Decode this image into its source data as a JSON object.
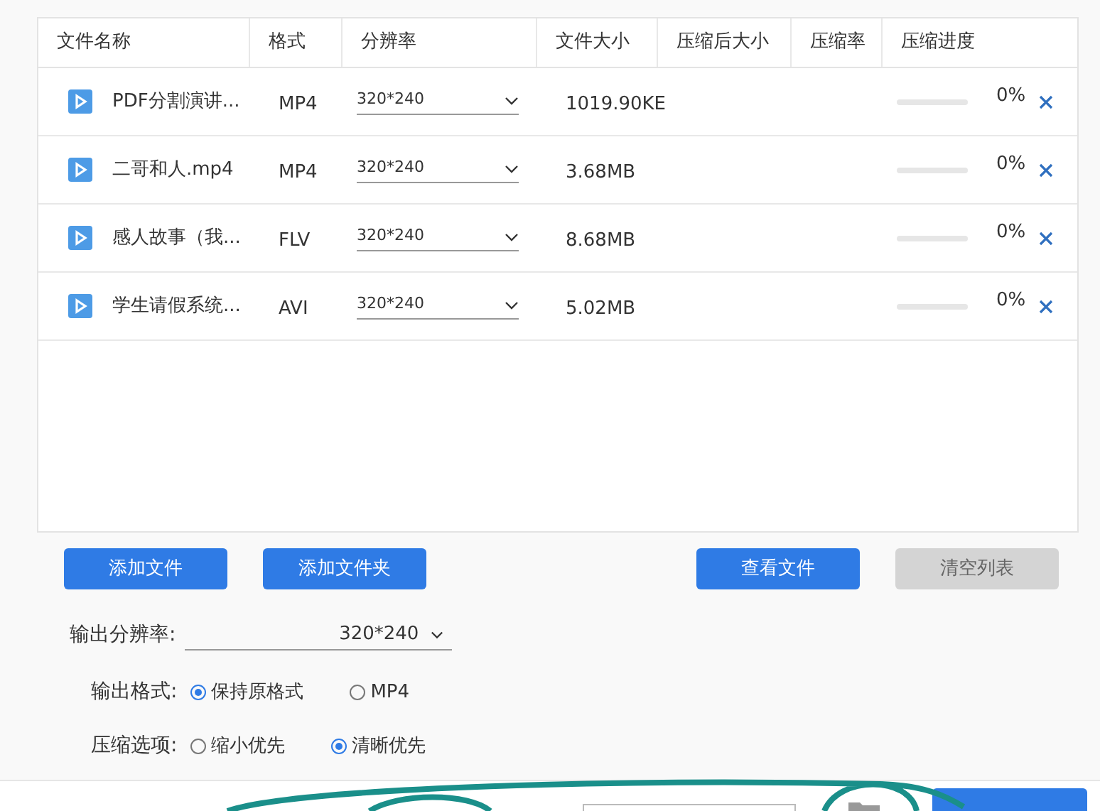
{
  "table": {
    "columns": [
      "文件名称",
      "格式",
      "分辨率",
      "文件大小",
      "压缩后大小",
      "压缩率",
      "压缩进度"
    ],
    "rows": [
      {
        "name": "PDF分割演讲...",
        "format": "MP4",
        "resolution": "320*240",
        "size": "1019.90KE",
        "level": 0,
        "percent": "0%"
      },
      {
        "name": "二哥和人.mp4",
        "format": "MP4",
        "resolution": "320*240",
        "size": "3.68MB",
        "level": 0,
        "percent": "0%"
      },
      {
        "name": "感人故事（我...",
        "format": "FLV",
        "resolution": "320*240",
        "size": "8.68MB",
        "level": 0,
        "percent": "0%"
      },
      {
        "name": "学生请假系统...",
        "format": "AVI",
        "resolution": "320*240",
        "size": "5.02MB",
        "level": 0,
        "percent": "0%"
      }
    ]
  },
  "buttons": [
    {
      "label": "添加文件",
      "disabled": false
    },
    {
      "label": "添加文件夹",
      "disabled": false
    },
    {
      "label": "查看文件",
      "disabled": false
    },
    {
      "label": "清空列表",
      "disabled": true
    }
  ],
  "output_resolution": {
    "label": "输出分辨率:",
    "value": "320*240"
  },
  "output_format": {
    "label": "输出格式:",
    "options": [
      {
        "label": "保持原格式",
        "selected": true
      },
      {
        "label": "MP4",
        "selected": false
      }
    ]
  },
  "compress_option": {
    "label": "压缩选项:",
    "options": [
      {
        "label": "缩小优先",
        "selected": false
      },
      {
        "label": "清晰优先",
        "selected": true
      }
    ]
  }
}
